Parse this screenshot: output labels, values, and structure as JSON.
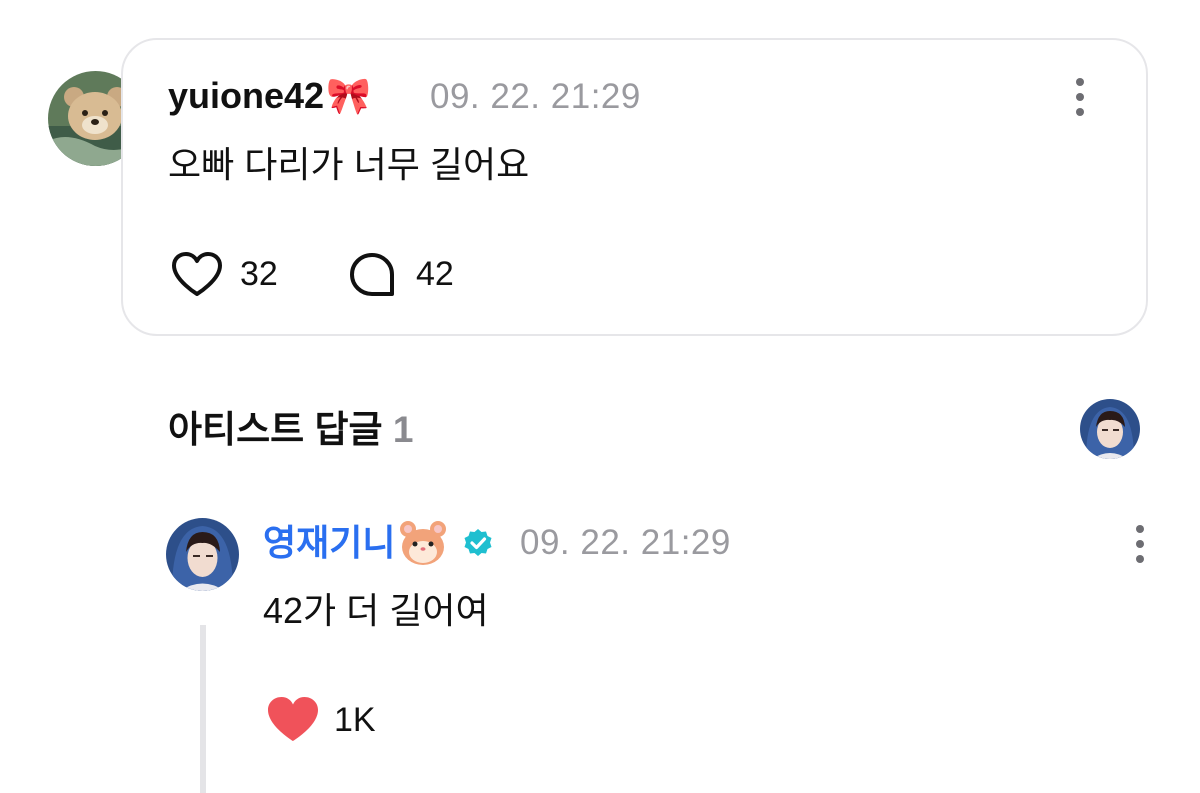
{
  "comment": {
    "username": "yuione42",
    "username_emoji": "🎀",
    "timestamp": "09. 22. 21:29",
    "text": "오빠 다리가 너무 길어요",
    "likes": "32",
    "replies": "42",
    "avatar_icon": "teddy-bear-avatar"
  },
  "artist_section": {
    "title": "아티스트 답글",
    "count": "1"
  },
  "reply": {
    "username": "영재기니",
    "username_emoji": "🐹",
    "verified_icon": "verified-badge-icon",
    "timestamp": "09. 22. 21:29",
    "text": "42가 더 길어여",
    "likes": "1K",
    "name_color": "#2a6ff0",
    "like_color": "#f0525a",
    "badge_color": "#1fbfd0"
  }
}
